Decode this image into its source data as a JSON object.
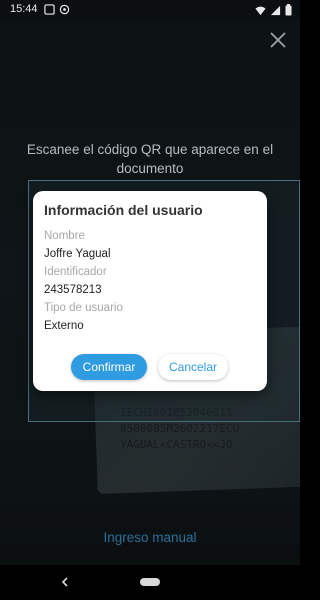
{
  "status_bar": {
    "time": "15:44"
  },
  "scan": {
    "instruction": "Escanee el código QR que aparece en el documento",
    "manual_entry_label": "Ingreso manual",
    "background_mrz": [
      "IECHI601853946811",
      "8508085M2602217ECU",
      "YAGUAL<CASTRO<<JO"
    ]
  },
  "dialog": {
    "title": "Información del usuario",
    "fields": [
      {
        "label": "Nombre",
        "value": "Joffre Yagual"
      },
      {
        "label": "Identificador",
        "value": "243578213"
      },
      {
        "label": "Tipo de usuario",
        "value": "Externo"
      }
    ],
    "confirm_label": "Confirmar",
    "cancel_label": "Cancelar"
  },
  "colors": {
    "accent": "#2f9be0",
    "link": "#2d6f9a"
  },
  "icons": {
    "close": "close-icon",
    "back": "back-icon",
    "wifi": "wifi-icon",
    "battery": "battery-icon"
  }
}
